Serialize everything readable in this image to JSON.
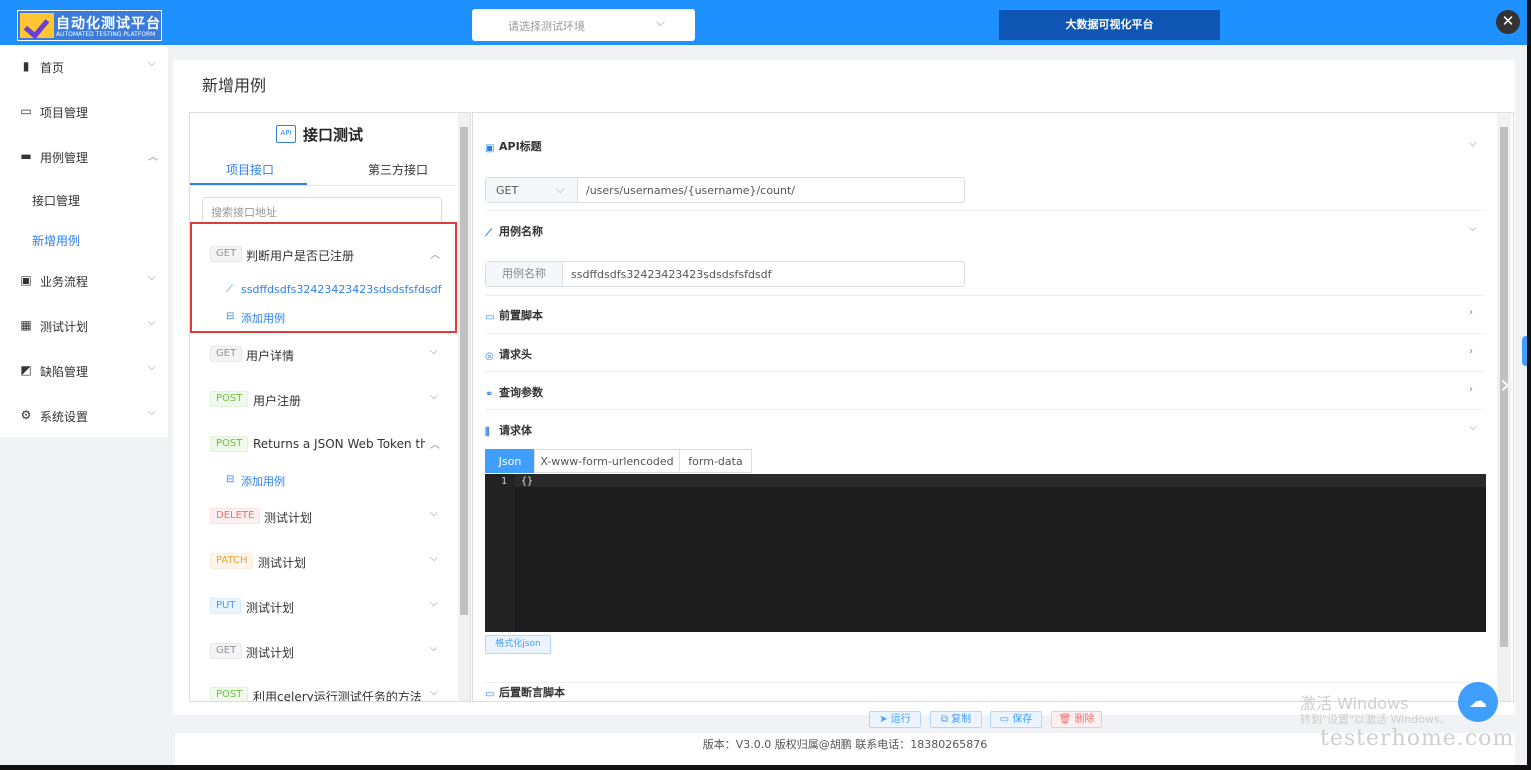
{
  "header": {
    "logo_title": "自动化测试平台",
    "logo_subtitle": "AUTOMATED TESTING PLATFORM",
    "env_placeholder": "请选择测试环境",
    "bigdata_label": "大数据可视化平台"
  },
  "sidebar": {
    "items": [
      {
        "label": "首页"
      },
      {
        "label": "项目管理"
      },
      {
        "label": "用例管理"
      },
      {
        "label": "接口管理"
      },
      {
        "label": "新增用例"
      },
      {
        "label": "业务流程"
      },
      {
        "label": "测试计划"
      },
      {
        "label": "缺陷管理"
      },
      {
        "label": "系统设置"
      }
    ]
  },
  "page": {
    "title": "新增用例"
  },
  "left_panel": {
    "title": "接口测试",
    "tabs": [
      "项目接口",
      "第三方接口"
    ],
    "search_placeholder": "搜索接口地址",
    "apis": [
      {
        "method": "GET",
        "name": "判断用户是否已注册",
        "cases": [
          "ssdffdsdfs32423423423sdsdsfsfdsdf"
        ],
        "add_label": "添加用例"
      },
      {
        "method": "GET",
        "name": "用户详情"
      },
      {
        "method": "POST",
        "name": "用户注册"
      },
      {
        "method": "POST",
        "name": "Returns a JSON Web Token th...",
        "add_label": "添加用例"
      },
      {
        "method": "DELETE",
        "name": "测试计划"
      },
      {
        "method": "PATCH",
        "name": "测试计划"
      },
      {
        "method": "PUT",
        "name": "测试计划"
      },
      {
        "method": "GET",
        "name": "测试计划"
      },
      {
        "method": "POST",
        "name": "利用celery运行测试任务的方法"
      }
    ]
  },
  "right_panel": {
    "api_title_label": "API标题",
    "method": "GET",
    "url": "/users/usernames/{username}/count/",
    "case_name_label": "用例名称",
    "case_name_prefix": "用例名称",
    "case_name_value": "ssdffdsdfs32423423423sdsdsfsfdsdf",
    "pre_script_label": "前置脚本",
    "headers_label": "请求头",
    "query_label": "查询参数",
    "body_label": "请求体",
    "body_tabs": [
      "Json",
      "X-www-form-urlencoded",
      "form-data"
    ],
    "editor_line_no": "1",
    "editor_code": "{}",
    "format_button": "格式化json",
    "post_assert_label": "后置断言脚本"
  },
  "actions": {
    "run": "运行",
    "copy": "复制",
    "save": "保存",
    "delete": "删除"
  },
  "footer": {
    "text": "版本：V3.0.0 版权归属@胡鹏 联系电话：18380265876"
  },
  "watermarks": {
    "win_title": "激活 Windows",
    "win_sub": "转到\"设置\"以激活 Windows。",
    "site": "testerhome.com"
  },
  "colors": {
    "primary": "#1e90ff",
    "accent": "#409eff",
    "bigdata_btn": "#0f56b4",
    "highlight_border": "#e03a3a"
  }
}
